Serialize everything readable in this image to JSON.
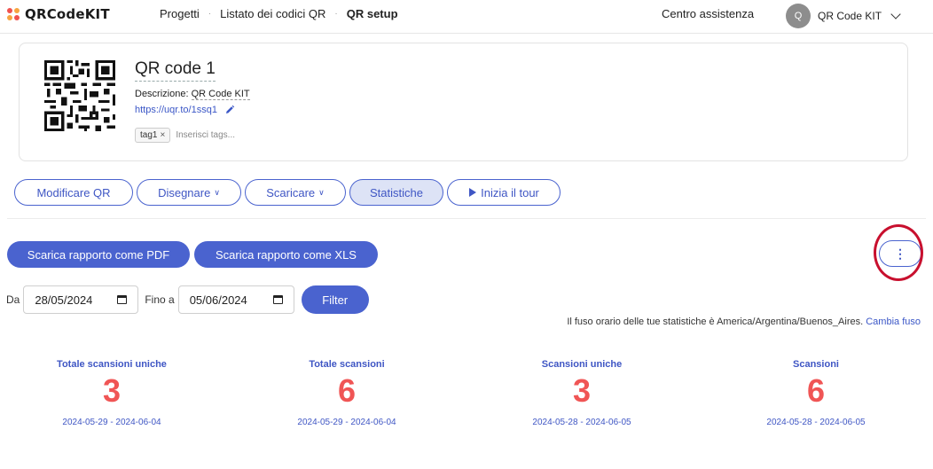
{
  "brand": {
    "name": "QRCodeKIT",
    "colors": {
      "dot1": "#f0524f",
      "dot2": "#f7a440",
      "dot3": "#f0524f",
      "dot4": "#f7a440"
    }
  },
  "nav": {
    "breadcrumb": [
      "Progetti",
      "Listato dei codici QR",
      "QR setup"
    ],
    "help": "Centro assistenza",
    "user_initial": "Q",
    "user_name": "QR Code KIT"
  },
  "qr": {
    "name": "QR code 1",
    "description_label": "Descrizione: ",
    "description_value": "QR Code KIT",
    "short_url": "https://uqr.to/1ssq1",
    "tags": [
      "tag1"
    ],
    "tag_remove": "×",
    "tag_placeholder": "Inserisci tags..."
  },
  "actions": [
    {
      "label": "Modificare QR",
      "caret": ""
    },
    {
      "label": "Disegnare",
      "caret": "∨"
    },
    {
      "label": "Scaricare",
      "caret": "∨"
    },
    {
      "label": "Statistiche",
      "caret": ""
    },
    {
      "label": "Inizia il tour",
      "caret": ""
    }
  ],
  "report": {
    "pdf": "Scarica rapporto come PDF",
    "xls": "Scarica rapporto come XLS",
    "more": "⋮"
  },
  "filter": {
    "from_label": "Da",
    "from_value": "28/05/2024",
    "to_label": "Fino a",
    "to_value": "05/06/2024",
    "button": "Filter"
  },
  "timezone": {
    "text": "Il fuso orario delle tue statistiche è America/Argentina/Buenos_Aires.",
    "link": "Cambia fuso"
  },
  "stats": [
    {
      "label": "Totale scansioni uniche",
      "value": "3",
      "range": "2024-05-29 - 2024-06-04"
    },
    {
      "label": "Totale scansioni",
      "value": "6",
      "range": "2024-05-29 - 2024-06-04"
    },
    {
      "label": "Scansioni uniche",
      "value": "3",
      "range": "2024-05-28 - 2024-06-05"
    },
    {
      "label": "Scansioni",
      "value": "6",
      "range": "2024-05-28 - 2024-06-05"
    }
  ]
}
